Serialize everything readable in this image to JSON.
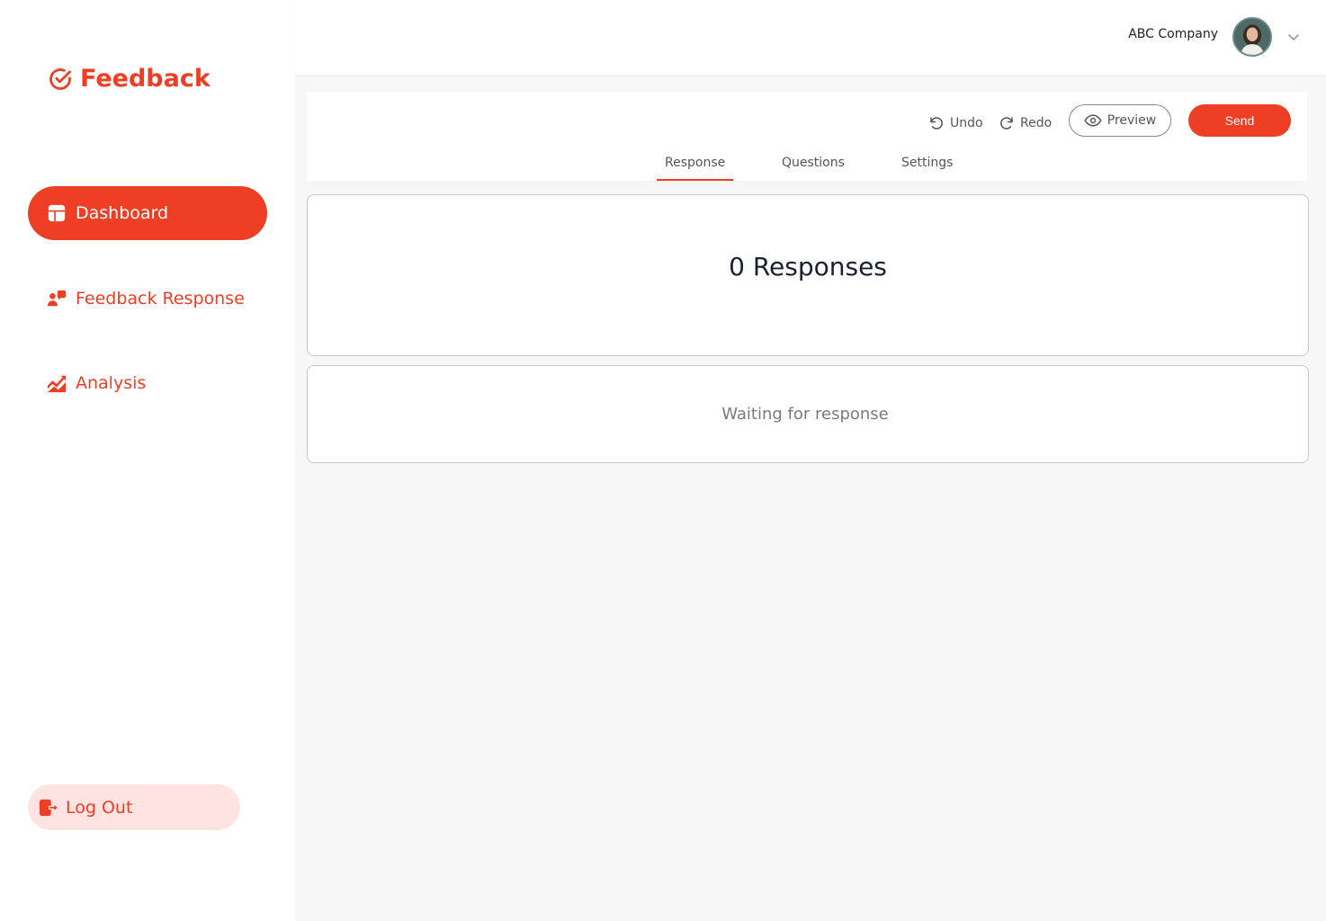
{
  "brand": {
    "name": "Feedback",
    "accent": "#ee3e23"
  },
  "sidebar": {
    "items": [
      {
        "label": "Dashboard",
        "icon": "dashboard-icon",
        "active": true
      },
      {
        "label": "Feedback Response",
        "icon": "users-chat-icon",
        "active": false
      },
      {
        "label": "Analysis",
        "icon": "chart-up-icon",
        "active": false
      }
    ],
    "logout_label": "Log Out"
  },
  "header": {
    "company": "ABC Company",
    "avatar_icon": "user-avatar",
    "menu_icon": "chevron-down-icon"
  },
  "toolbar": {
    "undo_label": "Undo",
    "redo_label": "Redo",
    "preview_label": "Preview",
    "send_label": "Send"
  },
  "tabs": [
    {
      "label": "Response",
      "active": true
    },
    {
      "label": "Questions",
      "active": false
    },
    {
      "label": "Settings",
      "active": false
    }
  ],
  "main": {
    "response_count_text": "0 Responses",
    "waiting_text": "Waiting for response"
  }
}
